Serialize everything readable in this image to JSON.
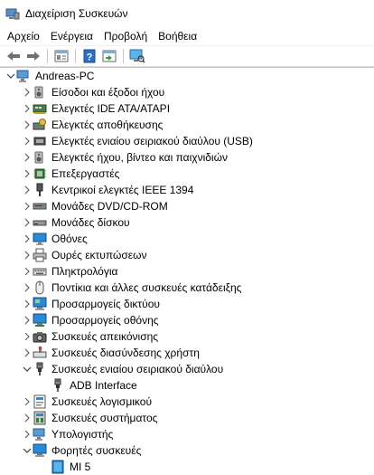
{
  "window": {
    "title": "Διαχείριση Συσκευών"
  },
  "menu": [
    "Αρχείο",
    "Ενέργεια",
    "Προβολή",
    "Βοήθεια"
  ],
  "tree": {
    "root": "Andreas-PC",
    "items": [
      {
        "label": "Είσοδοι και έξοδοι ήχου",
        "icon": "speaker-icon",
        "expanded": false,
        "level": 1
      },
      {
        "label": "Ελεγκτές IDE ATA/ATAPI",
        "icon": "ide-controller-icon",
        "expanded": false,
        "level": 1
      },
      {
        "label": "Ελεγκτές αποθήκευσης",
        "icon": "storage-controller-icon",
        "expanded": false,
        "level": 1
      },
      {
        "label": "Ελεγκτές ενιαίου σειριακού διαύλου (USB)",
        "icon": "usb-controller-icon",
        "expanded": false,
        "level": 1
      },
      {
        "label": "Ελεγκτές ήχου, βίντεο και παιχνιδιών",
        "icon": "speaker-icon",
        "expanded": false,
        "level": 1
      },
      {
        "label": "Επεξεργαστές",
        "icon": "processor-icon",
        "expanded": false,
        "level": 1
      },
      {
        "label": "Κεντρικοί ελεγκτές IEEE 1394",
        "icon": "ieee1394-icon",
        "expanded": false,
        "level": 1
      },
      {
        "label": "Μονάδες DVD/CD-ROM",
        "icon": "dvd-drive-icon",
        "expanded": false,
        "level": 1
      },
      {
        "label": "Μονάδες δίσκου",
        "icon": "disk-drive-icon",
        "expanded": false,
        "level": 1
      },
      {
        "label": "Οθόνες",
        "icon": "monitor-icon",
        "expanded": false,
        "level": 1
      },
      {
        "label": "Ουρές εκτυπώσεων",
        "icon": "printer-icon",
        "expanded": false,
        "level": 1
      },
      {
        "label": "Πληκτρολόγια",
        "icon": "keyboard-icon",
        "expanded": false,
        "level": 1
      },
      {
        "label": "Ποντίκια και άλλες συσκευές κατάδειξης",
        "icon": "mouse-icon",
        "expanded": false,
        "level": 1
      },
      {
        "label": "Προσαρμογείς δικτύου",
        "icon": "network-adapter-icon",
        "expanded": false,
        "level": 1
      },
      {
        "label": "Προσαρμογείς οθόνης",
        "icon": "display-adapter-icon",
        "expanded": false,
        "level": 1
      },
      {
        "label": "Συσκευές απεικόνισης",
        "icon": "camera-icon",
        "expanded": false,
        "level": 1
      },
      {
        "label": "Συσκευές διασύνδεσης χρήστη",
        "icon": "hid-icon",
        "expanded": false,
        "level": 1
      },
      {
        "label": "Συσκευές ενιαίου σειριακού διαύλου",
        "icon": "usb-plug-icon",
        "expanded": true,
        "level": 1
      },
      {
        "label": "ADB Interface",
        "icon": "usb-plug-icon",
        "expanded": null,
        "level": 2
      },
      {
        "label": "Συσκευές λογισμικού",
        "icon": "software-device-icon",
        "expanded": false,
        "level": 1
      },
      {
        "label": "Συσκευές συστήματος",
        "icon": "system-device-icon",
        "expanded": false,
        "level": 1
      },
      {
        "label": "Υπολογιστής",
        "icon": "computer-icon",
        "expanded": false,
        "level": 1
      },
      {
        "label": "Φορητές συσκευές",
        "icon": "portable-device-icon",
        "expanded": true,
        "level": 1
      },
      {
        "label": "MI 5",
        "icon": "phone-icon",
        "expanded": null,
        "level": 2
      }
    ]
  }
}
